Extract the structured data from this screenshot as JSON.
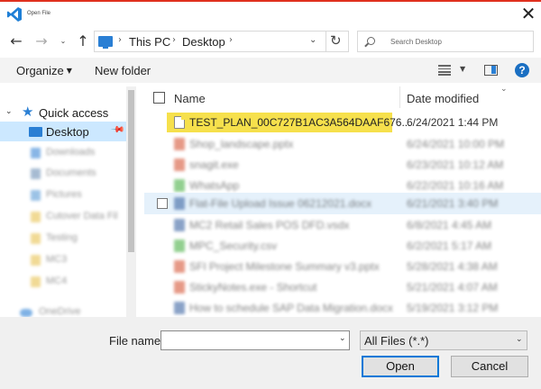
{
  "window": {
    "title": "Open File",
    "close_glyph": "✕",
    "accent_color": "#e0301e",
    "app_icon": "vscode-icon"
  },
  "nav": {
    "back": "←",
    "forward": "→",
    "recent": "⌄",
    "up": "↑",
    "crumbs": [
      "This PC",
      "Desktop"
    ],
    "refresh": "↻",
    "search_placeholder": "Search Desktop"
  },
  "toolbar": {
    "organize": "Organize",
    "new_folder": "New folder",
    "help": "?"
  },
  "sidebar": {
    "quick_access": "Quick access",
    "desktop": "Desktop",
    "blurred_items": [
      {
        "label": "Downloads",
        "color": "#3a86d6"
      },
      {
        "label": "Documents",
        "color": "#6c8fb5"
      },
      {
        "label": "Pictures",
        "color": "#5a9bd6"
      },
      {
        "label": "Cutover Data Fil",
        "color": "#e8c250"
      },
      {
        "label": "Testing",
        "color": "#e8c250"
      },
      {
        "label": "MC3",
        "color": "#e8c250"
      },
      {
        "label": "MC4",
        "color": "#e8c250"
      },
      {
        "label": "OneDrive",
        "color": "#2a7fd4"
      }
    ]
  },
  "columns": {
    "name": "Name",
    "date_modified": "Date modified"
  },
  "files": {
    "selected": {
      "name": "TEST_PLAN_00C727B1AC3A564DAAF676...",
      "date": "6/24/2021 1:44 PM",
      "highlight_color": "#f6e04c"
    },
    "blurred": [
      {
        "name": "Shop_landscape.pptx",
        "date": "6/24/2021 10:00 PM",
        "color": "#d24726"
      },
      {
        "name": "snagit.exe",
        "date": "6/23/2021 10:12 AM",
        "color": "#d24726"
      },
      {
        "name": "WhatsApp",
        "date": "6/22/2021 10:16 AM",
        "color": "#3aaa35"
      },
      {
        "name": "Flat-File Upload Issue 06212021.docx",
        "date": "6/21/2021 3:40 PM",
        "color": "#2b579a"
      },
      {
        "name": "MC2 Retail Sales POS DFD.vsdx",
        "date": "6/8/2021 4:45 AM",
        "color": "#2b579a"
      },
      {
        "name": "MPC_Security.csv",
        "date": "6/2/2021 5:17 AM",
        "color": "#3aaa35"
      },
      {
        "name": "SFI Project Milestone Summary v3.pptx",
        "date": "5/28/2021 4:38 AM",
        "color": "#d24726"
      },
      {
        "name": "StickyNotes.exe - Shortcut",
        "date": "5/21/2021 4:07 AM",
        "color": "#d24726"
      },
      {
        "name": "How to schedule SAP Data Migration.docx",
        "date": "5/19/2021 3:12 PM",
        "color": "#2b579a"
      }
    ]
  },
  "footer": {
    "file_name_label": "File name:",
    "file_name_value": "",
    "filter_value": "All Files (*.*)",
    "open": "Open",
    "cancel": "Cancel"
  }
}
